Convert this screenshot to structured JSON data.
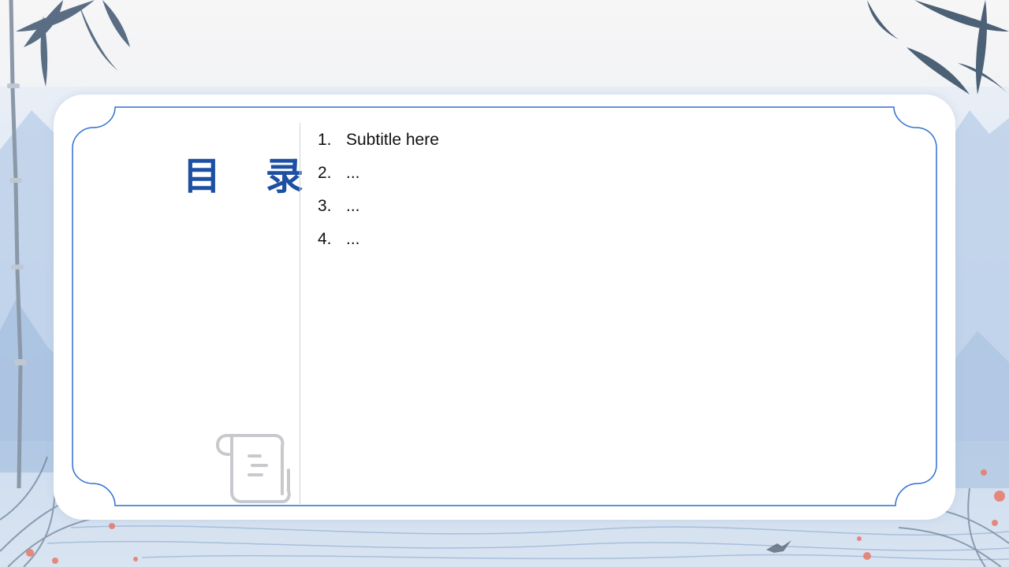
{
  "slide": {
    "title": "目 录",
    "toc": [
      {
        "number": "1.",
        "text": "Subtitle here"
      },
      {
        "number": "2.",
        "text": "..."
      },
      {
        "number": "3.",
        "text": "..."
      },
      {
        "number": "4.",
        "text": "..."
      }
    ],
    "icons": [
      "scroll-icon"
    ],
    "colors": {
      "title": "#1d4fa3",
      "frame": "#2f6fd1",
      "card": "#ffffff",
      "divider": "#d2d4d8"
    }
  }
}
